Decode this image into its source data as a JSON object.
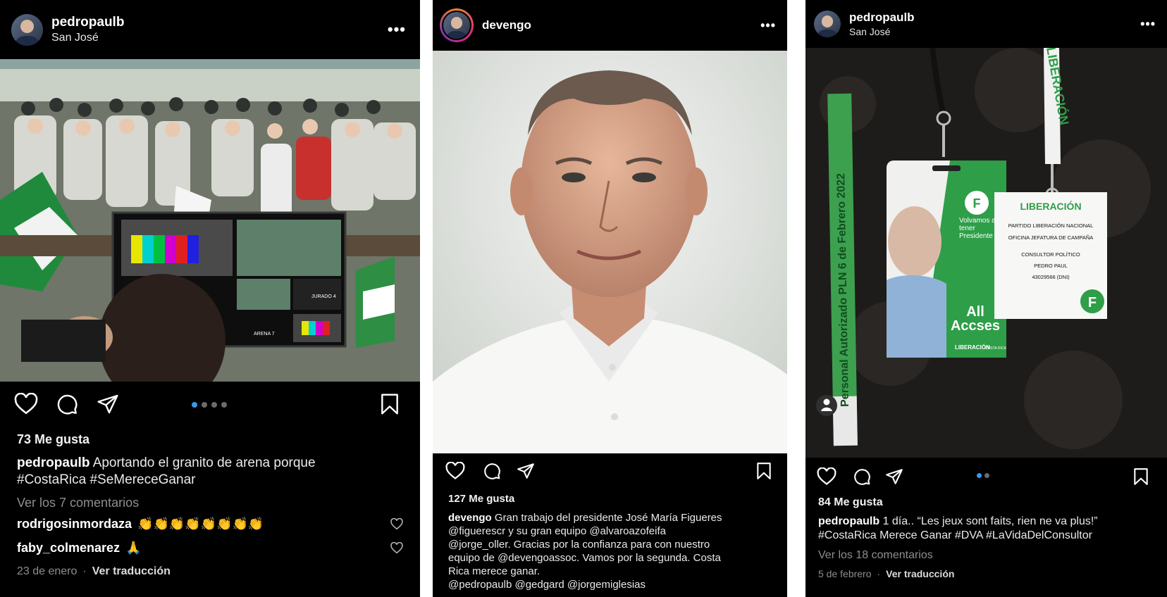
{
  "posts": [
    {
      "username": "pedropaulb",
      "location": "San José",
      "likes": "73 Me gusta",
      "caption_user": "pedropaulb",
      "caption_text": "Aportando el granito de arena porque",
      "caption_line2": "#CostaRica #SeMereceGanar",
      "view_comments": "Ver los 7 comentarios",
      "comments": [
        {
          "user": "rodrigosinmordaza",
          "text": "👏👏👏👏👏👏👏👏"
        },
        {
          "user": "faby_colmenarez",
          "text": "🙏"
        }
      ],
      "date": "23 de enero",
      "separator": "·",
      "translate": "Ver traducción",
      "photo": {
        "monitor_labels": [
          "JURADO 4",
          "ARENA 7"
        ]
      }
    },
    {
      "username": "devengo",
      "likes": "127 Me gusta",
      "caption_user": "devengo",
      "caption_lines": [
        "Gran trabajo del presidente José María Figueres",
        "@figuerescr y su gran equipo @alvaroazofeifa",
        "@jorge_oller. Gracias por la confianza para con nuestro",
        "equipo de @devengoassoc. Vamos por la segunda. Costa",
        "Rica merece ganar.",
        "@pedropaulb @gedgard @jorgemiglesias"
      ]
    },
    {
      "username": "pedropaulb",
      "location": "San José",
      "likes": "84 Me gusta",
      "caption_user": "pedropaulb",
      "caption_text": "1 día.. “Les jeux sont faits, rien ne va plus!”",
      "caption_line2": "#CostaRica Merece Ganar #DVA #LaVidaDelConsultor",
      "view_comments": "Ver los 18 comentarios",
      "date": "5 de febrero",
      "separator": "·",
      "translate": "Ver traducción",
      "photo": {
        "wristband_text": "Personal Autorizado PLN 6 de Febrero 2022",
        "lanyard_text": "LIBERACIÓN",
        "badge_slogan": "Volvamos a tener Presidente",
        "badge_access": "All Accses",
        "badge_brand": "LIBERACIÓN",
        "badge_sub": "COSTA RICA",
        "badge_logo": "F",
        "card_title": "LIBERACIÓN",
        "card_lines": [
          "PARTIDO LIBERACIÓN NACIONAL",
          "OFICINA JEFATURA DE CAMPAÑA",
          "CONSULTOR POLÍTICO",
          "PEDRO PAUL",
          "43029566 (DNI)"
        ],
        "card_logo": "F"
      }
    }
  ],
  "colors": {
    "background": "#000000",
    "dot_active": "#3897f0",
    "party_green": "#2e9e48"
  }
}
